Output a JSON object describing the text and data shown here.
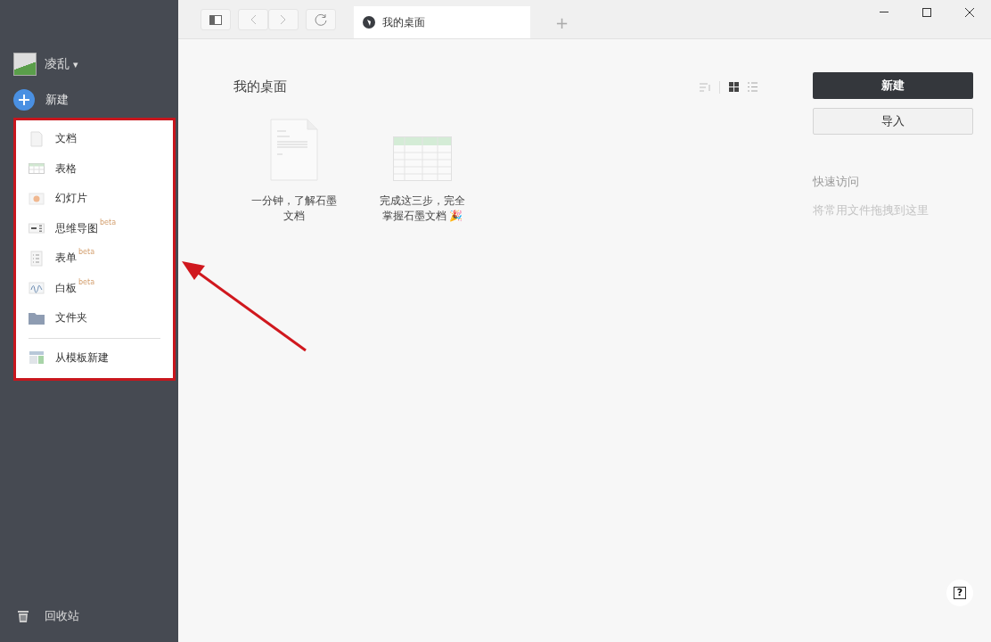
{
  "sidebar": {
    "user": {
      "name": "凌乱",
      "caret": "▾"
    },
    "new_label": "新建",
    "trash_label": "回收站"
  },
  "new_menu": {
    "items": [
      {
        "kind": "doc",
        "label": "文档"
      },
      {
        "kind": "sheet",
        "label": "表格"
      },
      {
        "kind": "slides",
        "label": "幻灯片"
      },
      {
        "kind": "mindmap",
        "label": "思维导图",
        "badge": "beta"
      },
      {
        "kind": "form",
        "label": "表单",
        "badge": "beta"
      },
      {
        "kind": "board",
        "label": "白板",
        "badge": "beta"
      },
      {
        "kind": "folder",
        "label": "文件夹"
      }
    ],
    "template_item": {
      "kind": "template",
      "label": "从模板新建"
    }
  },
  "toolbar": {
    "tabs": [
      {
        "label": "我的桌面",
        "selected": true
      }
    ],
    "add_tab": "+"
  },
  "desktop": {
    "title": "我的桌面",
    "view_buttons": [
      {
        "kind": "grid",
        "selected": true
      },
      {
        "kind": "list",
        "selected": false
      }
    ],
    "files": [
      {
        "kind": "doc",
        "name": "一分钟，了解石墨文档"
      },
      {
        "kind": "sheet",
        "name": "完成这三步，完全掌握石墨文档",
        "emoji": "🎉"
      }
    ]
  },
  "right_panel": {
    "new_button": "新建",
    "import_button": "导入",
    "quick_title": "快速访问",
    "quick_hint": "将常用文件拖拽到这里"
  },
  "help": "?"
}
